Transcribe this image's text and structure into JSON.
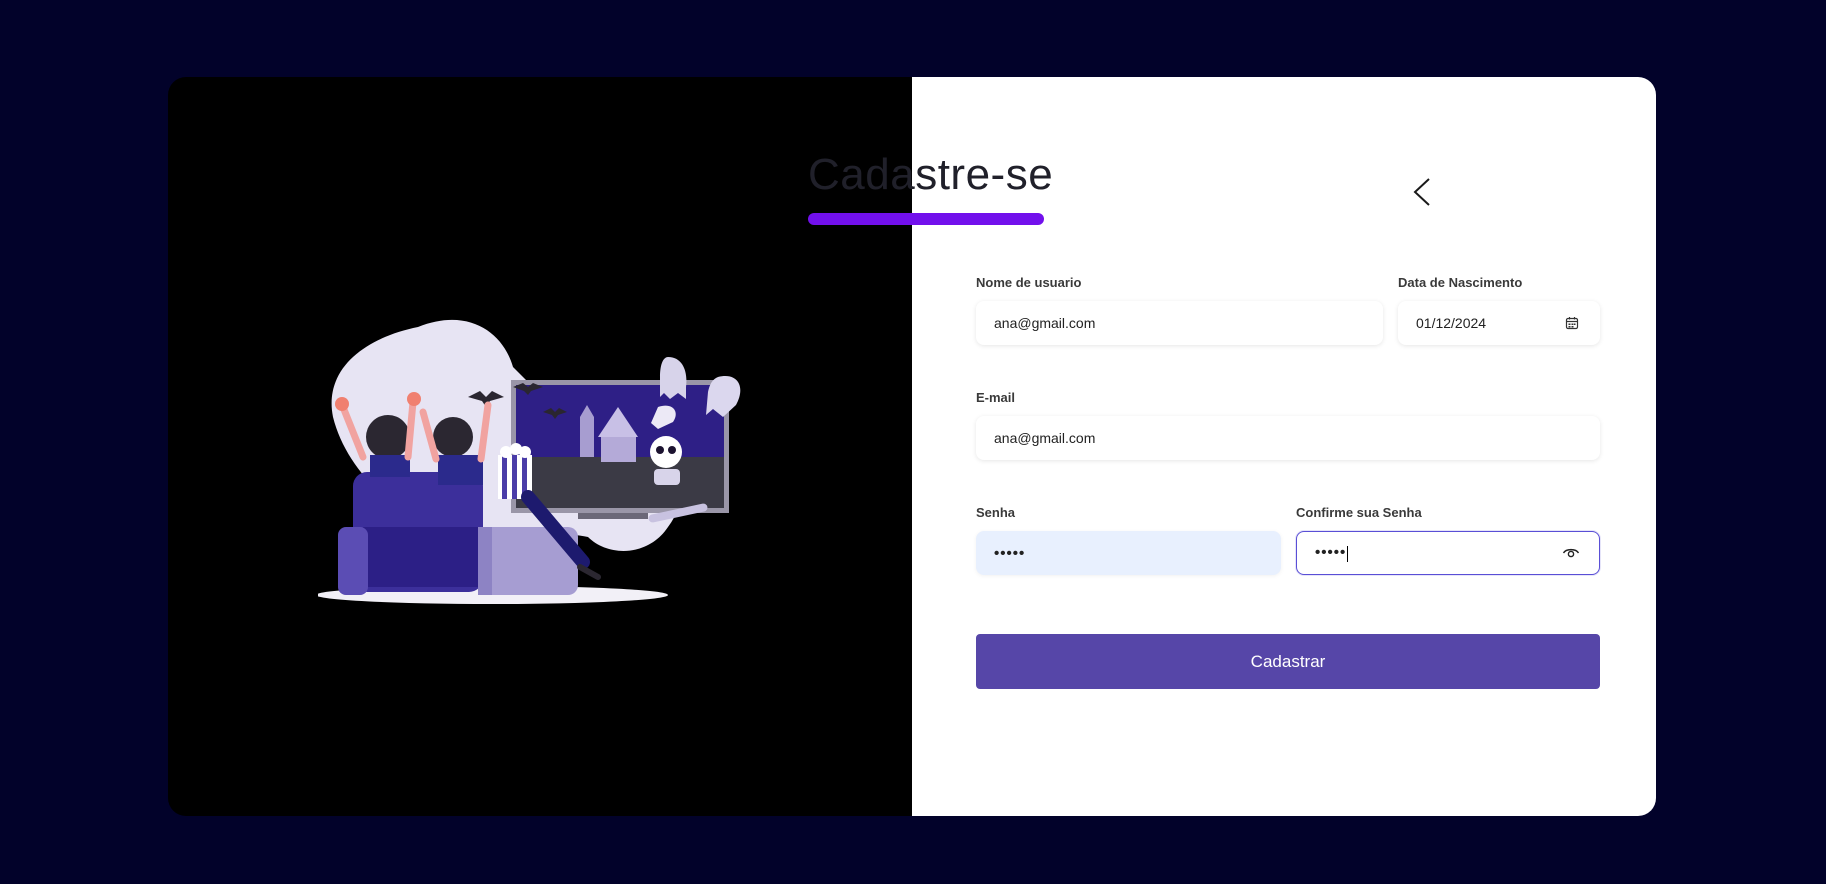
{
  "form": {
    "title": "Cadastre-se",
    "username": {
      "label": "Nome de usuario",
      "value": "ana@gmail.com"
    },
    "birthdate": {
      "label": "Data de Nascimento",
      "value": "01/12/2024",
      "icon": "calendar-icon"
    },
    "email": {
      "label": "E-mail",
      "value": "ana@gmail.com"
    },
    "password": {
      "label": "Senha",
      "masked_value": "•••••"
    },
    "confirm_password": {
      "label": "Confirme sua Senha",
      "masked_value": "•••••",
      "icon": "eye-icon"
    },
    "submit_label": "Cadastrar",
    "back_icon": "chevron-left-icon"
  },
  "colors": {
    "page_background": "#02022a",
    "accent_bar": "#7210ec",
    "button": "#5646a8",
    "focus_border": "#5a4fd6",
    "autofill_background": "#e8f0fe"
  }
}
